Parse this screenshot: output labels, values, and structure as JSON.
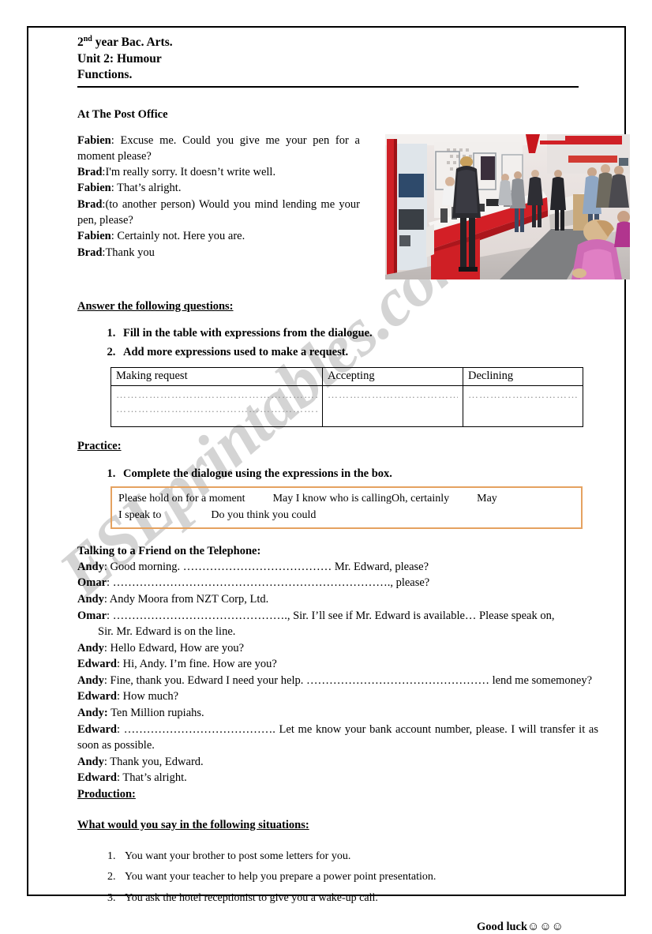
{
  "header": {
    "line1_prefix": "2",
    "line1_sup": "nd",
    "line1_rest": " year Bac. Arts.",
    "line2": "Unit 2: Humour",
    "line3": "Functions."
  },
  "watermark": {
    "text": "ESLprintables.com"
  },
  "dialogue_section": {
    "title": "At The Post Office",
    "lines": [
      {
        "speaker": "Fabien",
        "sep": ": ",
        "text": "Excuse me. Could you give me your pen for a moment please?"
      },
      {
        "speaker": "Brad",
        "sep": ":",
        "text": "I'm really sorry. It doesn’t write well."
      },
      {
        "speaker": "Fabien",
        "sep": ": ",
        "text": "That’s alright."
      },
      {
        "speaker": "Brad",
        "sep": ":",
        "text": "(to another person) Would you mind lending me your pen, please?"
      },
      {
        "speaker": "Fabien",
        "sep": ": ",
        "text": "Certainly not. Here you are."
      },
      {
        "speaker": "Brad",
        "sep": ":",
        "text": "Thank you"
      }
    ],
    "photo_alt": "post-office-counter-queue"
  },
  "answer_section": {
    "heading": "Answer the following questions:",
    "questions": [
      "Fill in the table with expressions from the dialogue.",
      "Add more expressions used to make a request."
    ]
  },
  "table": {
    "headers": [
      "Making request",
      "Accepting",
      "Declining"
    ],
    "rows": [
      {
        "making_request": "………………………………………………………………………………………………………………………",
        "making_request2": "………………………………………………………………………………………………………………",
        "accepting": "…………………………………………………………",
        "declining": "…………………………………………………"
      }
    ]
  },
  "practice_section": {
    "heading": "Practice:",
    "instruction": "Complete the dialogue using the expressions in the box.",
    "expression_box": {
      "row1": "Please hold on for a moment          May I know who is callingOh, certainly          May",
      "row2": "I speak to                  Do you think you could"
    },
    "border_color": "#E5A260"
  },
  "telephone_section": {
    "heading": "Talking to a Friend on the Telephone:",
    "lines": [
      {
        "speaker": "Andy",
        "sep": ": ",
        "text": "Good morning. ………………………………… Mr. Edward, please?"
      },
      {
        "speaker": "Omar",
        "sep": ": ",
        "text": "………………………………………………………………., please?"
      },
      {
        "speaker": "Andy",
        "sep": ": ",
        "text": " Andy Moora from NZT Corp, Ltd."
      },
      {
        "speaker": "Omar",
        "sep": ": ",
        "text": " ………………………………………., Sir. I’ll see if Mr. Edward is available… Please speak on,"
      },
      {
        "speaker": "",
        "sep": "",
        "text": "Sir. Mr. Edward is on the line.",
        "indent": true
      },
      {
        "speaker": "Andy",
        "sep": ": ",
        "text": " Hello Edward, How are you?"
      },
      {
        "speaker": "Edward",
        "sep": ": ",
        "text": " Hi, Andy. I’m fine. How are you?"
      },
      {
        "speaker": "Andy",
        "sep": ": ",
        "text": " Fine, thank you. Edward I need your help. ………………………………………… lend me somemoney?",
        "justify": true
      },
      {
        "speaker": "Edward",
        "sep": ": ",
        "text": " How much?"
      },
      {
        "speaker": "Andy:",
        "sep": " ",
        "text": "Ten Million rupiahs."
      },
      {
        "speaker": "Edward",
        "sep": ": ",
        "text": " …………………………………. Let me know your bank account number, please. I will transfer it   as soon as possible.",
        "justify": true
      },
      {
        "speaker": "Andy",
        "sep": ": ",
        "text": " Thank you, Edward."
      },
      {
        "speaker": "Edward",
        "sep": ": ",
        "text": " That’s alright."
      }
    ],
    "production_heading": "Production:"
  },
  "production_section": {
    "heading": "What would you say in the following situations:",
    "situations": [
      "You want your brother to post some letters for you.",
      "You want your teacher to help you prepare a power point presentation.",
      "You ask the hotel receptionist to give you a wake-up call."
    ],
    "closing": "Good luck",
    "closing_smileys": "☺☺☺"
  }
}
